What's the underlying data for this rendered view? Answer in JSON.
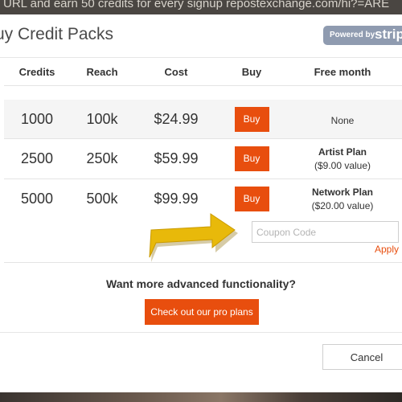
{
  "background": {
    "top_text": "URL and earn 50 credits for every signup  repostexchange.com/hi?=ARE"
  },
  "modal": {
    "title": "uy Credit Packs",
    "stripe_badge": {
      "powered_by": "Powered by",
      "brand": "stripe"
    }
  },
  "table": {
    "headers": [
      "Credits",
      "Reach",
      "Cost",
      "Buy",
      "Free month"
    ],
    "rows": [
      {
        "credits": "1000",
        "reach": "100k",
        "cost": "$24.99",
        "buy_label": "Buy",
        "plan": "",
        "plan_value": "None"
      },
      {
        "credits": "2500",
        "reach": "250k",
        "cost": "$59.99",
        "buy_label": "Buy",
        "plan": "Artist Plan",
        "plan_value": "($9.00 value)"
      },
      {
        "credits": "5000",
        "reach": "500k",
        "cost": "$99.99",
        "buy_label": "Buy",
        "plan": "Network Plan",
        "plan_value": "($20.00 value)"
      }
    ]
  },
  "coupon": {
    "placeholder": "Coupon Code",
    "value": "",
    "apply_label": "Apply"
  },
  "promo": {
    "text": "Want more advanced functionality?",
    "button_label": "Check out our pro plans"
  },
  "footer": {
    "cancel_label": "Cancel"
  },
  "colors": {
    "accent": "#e84e0e",
    "arrow": "#e8b90a",
    "stripe_badge": "#8f9bb0"
  }
}
